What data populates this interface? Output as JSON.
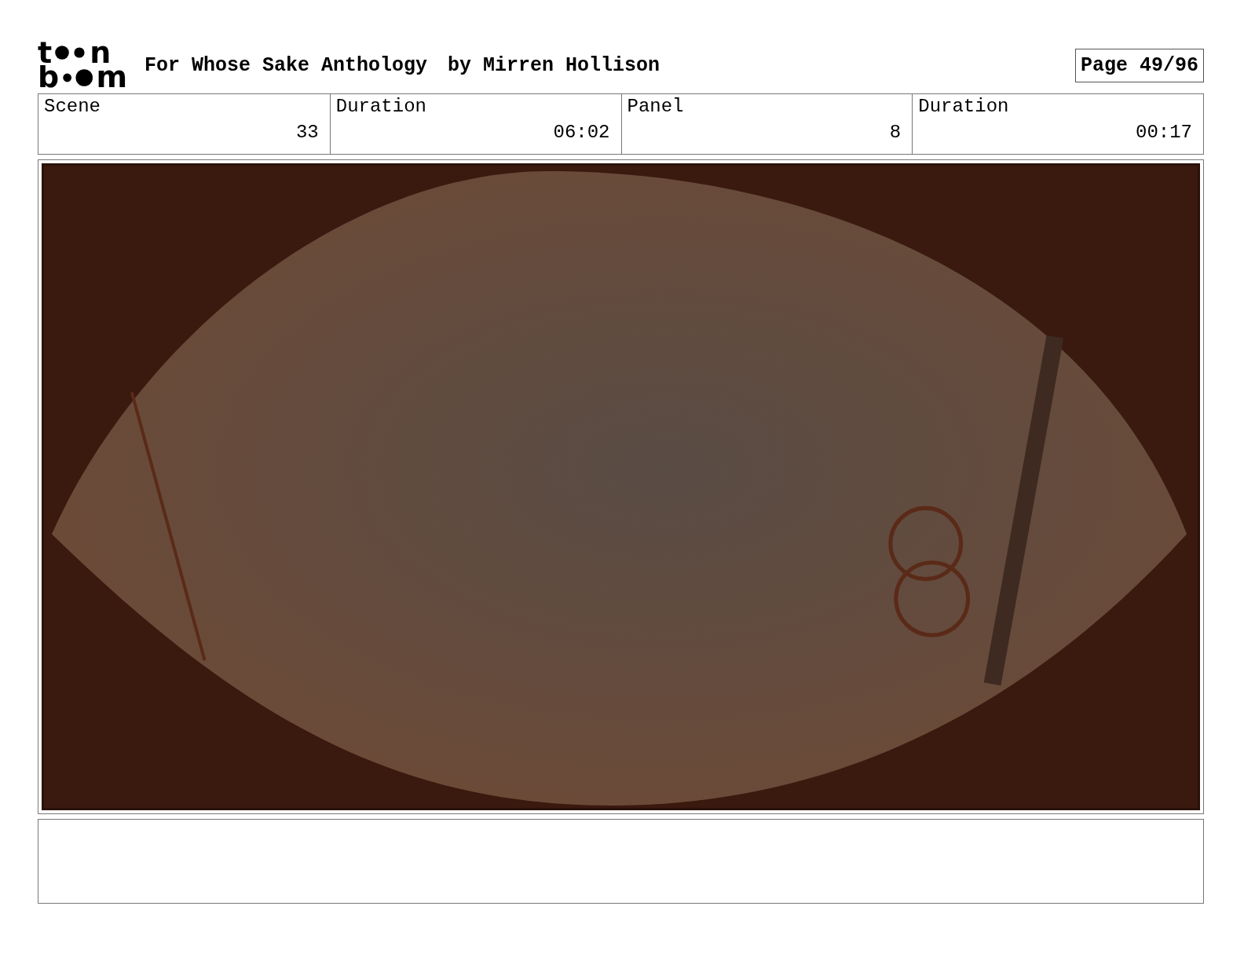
{
  "logo": {
    "top": [
      "t",
      "n"
    ],
    "bottom": [
      "b",
      "m"
    ]
  },
  "title": "For Whose Sake Anthology",
  "author": "by Mirren Hollison",
  "page": "Page 49/96",
  "fields": [
    {
      "label": "Scene",
      "value": "33"
    },
    {
      "label": "Duration",
      "value": "06:02"
    },
    {
      "label": "Panel",
      "value": "8"
    },
    {
      "label": "Duration",
      "value": "00:17"
    }
  ]
}
